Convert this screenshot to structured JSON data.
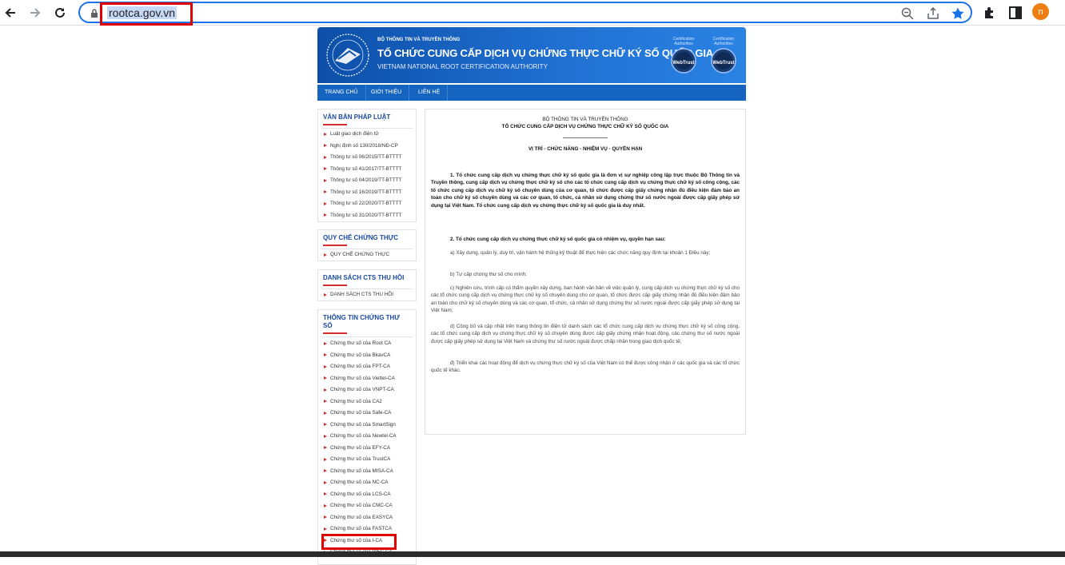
{
  "browser": {
    "url": "rootca.gov.vn",
    "avatar_letter": "n",
    "icons": [
      "back-icon",
      "forward-icon",
      "reload-icon",
      "lock-icon",
      "zoom-icon",
      "share-icon",
      "bookmark-star-icon",
      "extensions-icon",
      "side-panel-icon"
    ]
  },
  "banner": {
    "ministry": "BỘ THÔNG TIN VÀ TRUYỀN THÔNG",
    "title": "TỔ CHỨC CUNG CẤP DỊCH VỤ CHỨNG THỰC CHỮ KÝ SỐ QUỐC GIA",
    "subtitle": "VIETNAM NATIONAL ROOT CERTIFICATION AUTHORITY",
    "badges": [
      {
        "top": "Certification Authorities",
        "name": "WebTrust"
      },
      {
        "top": "Certification Authorities",
        "name": "WebTrust"
      }
    ]
  },
  "menu": [
    "TRANG CHỦ",
    "GIỚI THIỆU",
    "LIÊN HỆ"
  ],
  "sidebar": {
    "legal": {
      "title": "VĂN BẢN PHÁP LUẬT",
      "items": [
        "Luật giao dịch điện tử",
        "Nghị định số 130/2018/NĐ-CP",
        "Thông tư số 06/2015/TT-BTTTT",
        "Thông tư số 41/2017/TT-BTTTT",
        "Thông tư số 04/2019/TT-BTTTT",
        "Thông tư số 16/2019/TT-BTTTT",
        "Thông tư số 22/2020/TT-BTTTT",
        "Thông tư số 31/2020/TT-BTTTT"
      ]
    },
    "rules": {
      "title": "QUY CHẾ CHỨNG THỰC",
      "items": [
        "QUY CHẾ CHỨNG THỰC"
      ]
    },
    "revoked": {
      "title": "DANH SÁCH CTS THU HỒI",
      "items": [
        "DANH SÁCH CTS THU HỒI"
      ]
    },
    "certs": {
      "title": "THÔNG TIN CHỨNG THƯ SỐ",
      "items": [
        "Chứng thư số của Root CA",
        "Chứng thư số của BkavCA",
        "Chứng thư số của FPT-CA",
        "Chứng thư số của Viettel-CA",
        "Chứng thư số của VNPT-CA",
        "Chứng thư số của CA2",
        "Chứng thư số của Safe-CA",
        "Chứng thư số của SmartSign",
        "Chứng thư số của Newtel-CA",
        "Chứng thư số của EFY-CA",
        "Chứng thư số của TrustCA",
        "Chứng thư số của MISA-CA",
        "Chứng thư số của NC-CA",
        "Chứng thư số của LCS-CA",
        "Chứng thư số của CMC-CA",
        "Chứng thư số của EASYCA",
        "Chứng thư số của FASTCA",
        "Chứng thư số của I-CA",
        "Chứng thư số của VIỆC CA"
      ]
    }
  },
  "content": {
    "ministry": "BỘ THÔNG TIN VÀ TRUYỀN THÔNG",
    "org": "TỔ CHỨC CUNG CẤP DỊCH VỤ CHỨNG THỰC CHỮ KÝ SỐ QUỐC GIA",
    "heading": "VỊ TRÍ - CHỨC NĂNG - NHIỆM VỤ - QUYỀN HẠN",
    "p1": "1. Tổ chức cung cấp dịch vụ chứng thực chữ ký số quốc gia là đơn vị sự nghiệp công lập trực thuộc Bộ Thông tin và Truyền thông, cung cấp dịch vụ chứng thực chữ ký số cho các tổ chức cung cấp dịch vụ chứng thực chữ ký số công cộng, các tổ chức cung cấp dịch vụ chữ ký số chuyên dùng của cơ quan, tổ chức được cấp giấy chứng nhận đủ điều kiện đảm bảo an toàn cho chữ ký số chuyên dùng và các cơ quan, tổ chức, cá nhân sử dụng chứng thư số nước ngoài được cấp giấy phép sử dụng tại Việt Nam. Tổ chức cung cấp dịch vụ chứng thực chữ ký số quốc gia là duy nhất.",
    "p2": "2. Tổ chức cung cấp dịch vụ chứng thực chữ ký số quốc gia có nhiệm vụ, quyền hạn sau:",
    "pa": "a) Xây dựng, quản lý, duy trì, vận hành hệ thống kỹ thuật để thực hiện các chức năng quy định tại khoản 1 Điều này;",
    "pb": "b) Tự cấp chứng thư số cho mình;",
    "pc": "c) Nghiên cứu, trình cấp có thẩm quyền xây dựng, ban hành văn bản về việc quản lý, cung cấp dịch vụ chứng thực chữ ký số cho các tổ chức cung cấp dịch vụ chứng thực chữ ký số chuyên dùng cho cơ quan, tổ chức được cấp giấy chứng nhận đủ điều kiện đảm bảo an toàn cho chữ ký số chuyên dùng và các cơ quan, tổ chức, cá nhân sử dụng chứng thư số nước ngoài được cấp giấy phép sử dụng tại Việt Nam;",
    "pd": "d) Công bố và cập nhật trên trang thông tin điện tử danh sách các tổ chức cung cấp dịch vụ chứng thực chữ ký số công cộng, các tổ chức cung cấp dịch vụ chứng thực chữ ký số chuyên dùng được cấp giấy chứng nhận hoạt động, các chứng thư số nước ngoài được cấp giấy phép sử dụng tại Việt Nam và chứng thư số nước ngoài được chấp nhận trong giao dịch quốc tế;",
    "pe": "đ) Triển khai các hoạt động để dịch vụ chứng thực chữ ký số của Việt Nam có thể được công nhận ở các quốc gia và các tổ chức quốc tế khác."
  },
  "colors": {
    "accent": "#1a73e8",
    "banner": "#1565c0",
    "highlight": "#e00000"
  }
}
